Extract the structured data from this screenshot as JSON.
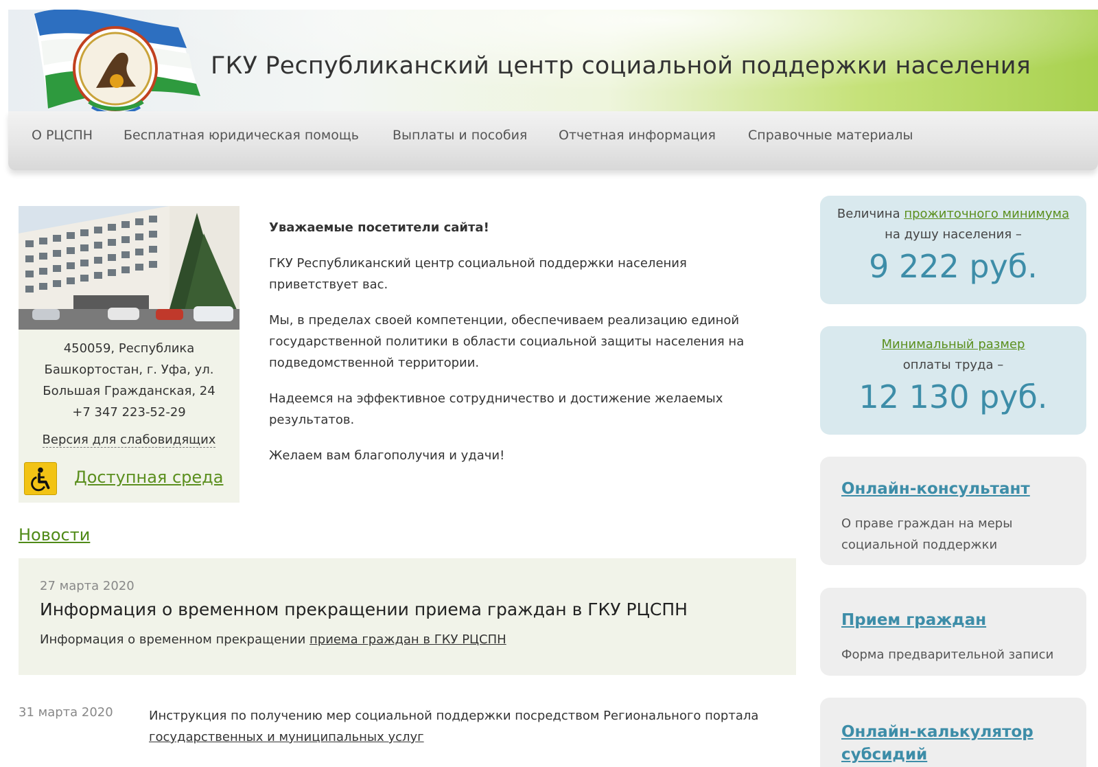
{
  "header": {
    "title": "ГКУ Республиканский центр социальной поддержки населения"
  },
  "nav": {
    "items": [
      {
        "label": "О РЦСПН"
      },
      {
        "label": "Бесплатная юридическая помощь"
      },
      {
        "label": "Выплаты и пособия"
      },
      {
        "label": "Отчетная информация"
      },
      {
        "label": "Справочные материалы"
      }
    ]
  },
  "contacts": {
    "address_lines": [
      "450059, Республика",
      "Башкортостан, г. Уфа, ул.",
      "Большая Гражданская, 24"
    ],
    "phone": "+7 347 223-52-29",
    "vision_link": "Версия для слабовидящих",
    "access_link": "Доступная среда"
  },
  "welcome": {
    "greeting": "Уважаемые посетители сайта!",
    "paragraphs": [
      "ГКУ Республиканский центр социальной поддержки населения приветствует вас.",
      "Мы, в пределах своей компетенции, обеспечиваем реализацию единой государственной политики в области социальной защиты населения на подведомственной территории.",
      "Надеемся на эффективное сотрудничество и достижение желаемых результатов.",
      "Желаем вам благополучия и удачи!"
    ]
  },
  "news": {
    "title": "Новости",
    "featured": {
      "date": "27 марта 2020",
      "title": "Информация о временном прекращении приема граждан в ГКУ РЦСПН",
      "desc_prefix": "Информация о временном прекращении ",
      "desc_link": "приема граждан в ГКУ РЦСПН"
    },
    "items": [
      {
        "date": "31 марта 2020",
        "text": "Инструкция по получению мер социальной поддержки посредством Регионального портала ",
        "link": "государственных и муниципальных услуг"
      }
    ]
  },
  "sidebar": {
    "subsistence": {
      "prefix": "Величина ",
      "link": "прожиточного минимума",
      "line2": "на душу населения –",
      "value": "9 222 руб."
    },
    "min_wage": {
      "link": "Минимальный размер",
      "line2": "оплаты труда –",
      "value": "12 130 руб."
    },
    "cards": [
      {
        "link": "Онлайн-консультант",
        "desc": "О праве граждан на меры социальной поддержки"
      },
      {
        "link": "Прием граждан",
        "desc": "Форма предварительной записи"
      },
      {
        "link": "Онлайн-калькулятор субсидий",
        "desc": ""
      }
    ]
  },
  "colors": {
    "accent_green": "#5b8f1e",
    "accent_blue": "#3d8da8",
    "flag_green": "#2e9a3e",
    "flag_blue": "#2d6fc0"
  }
}
